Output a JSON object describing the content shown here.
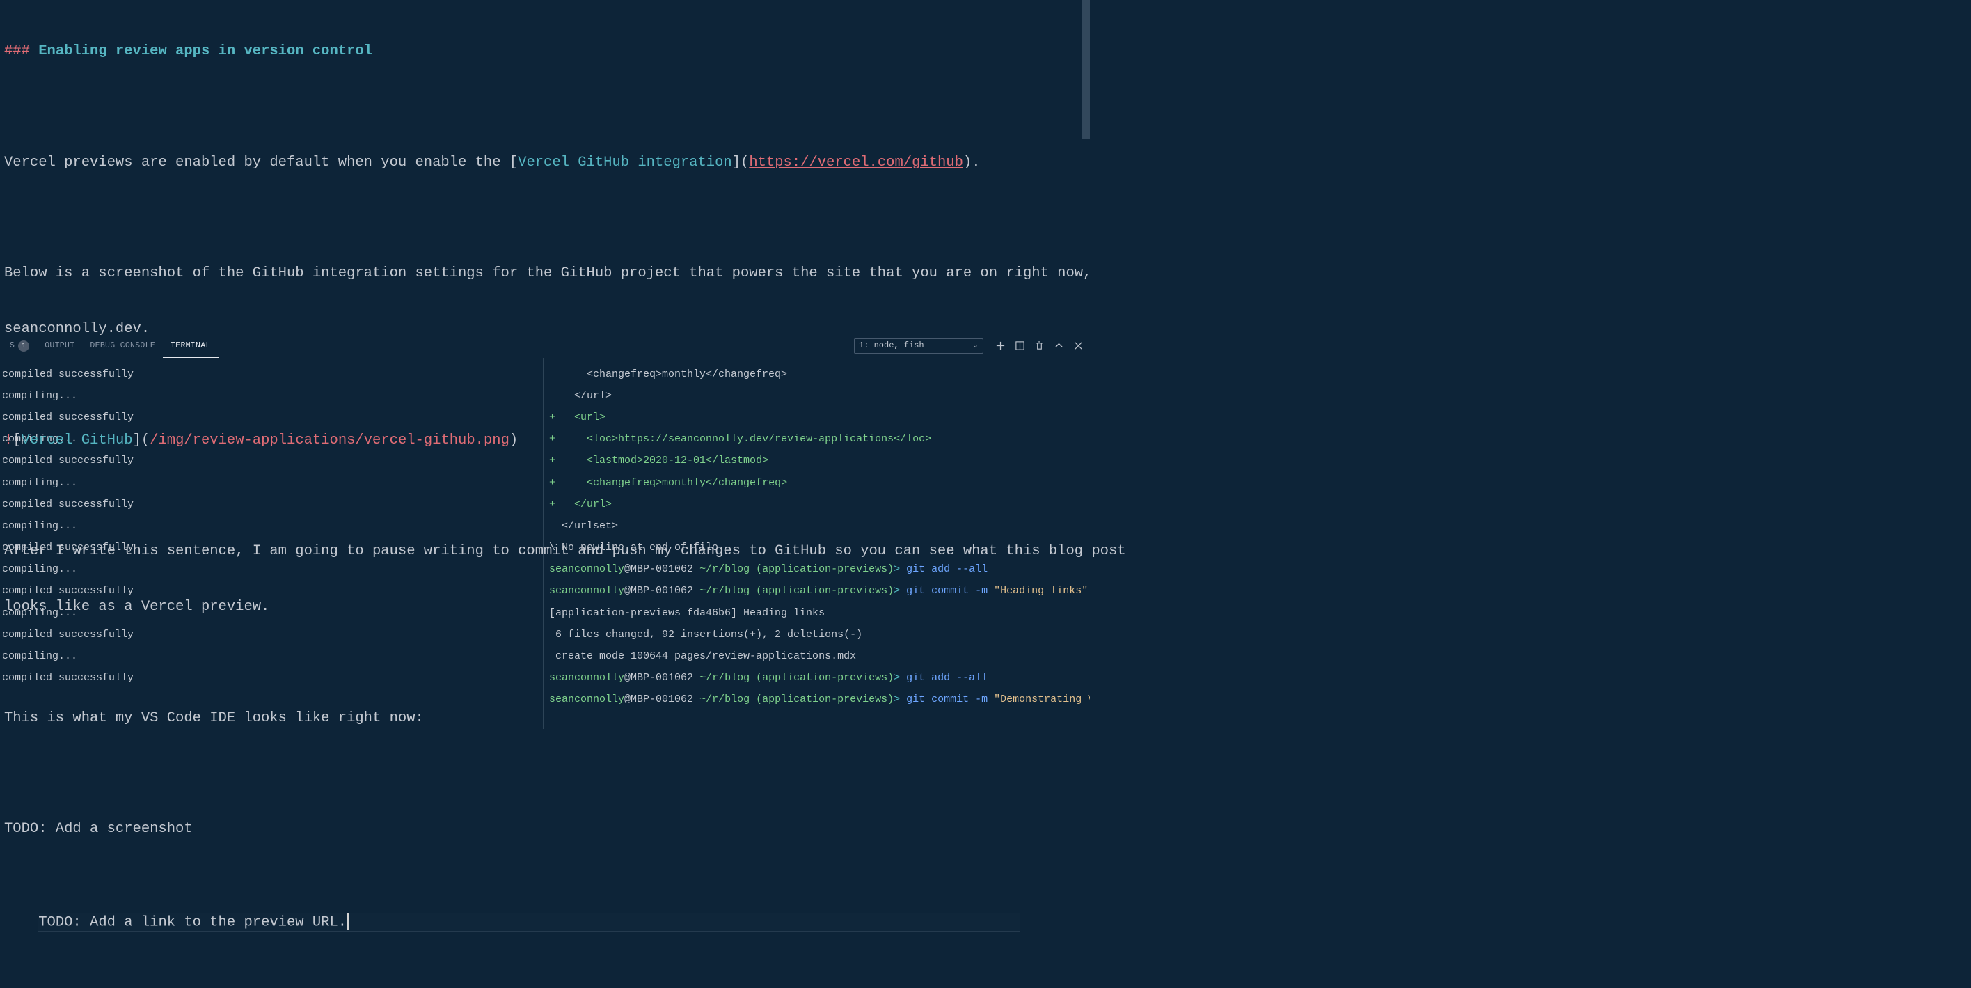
{
  "editor": {
    "heading_hash": "### ",
    "heading_text": "Enabling review apps in version control",
    "p1_pre": "Vercel previews are enabled by default when you enable the ",
    "p1_lb": "[",
    "p1_link_label": "Vercel GitHub integration",
    "p1_rb": "]",
    "p1_lp": "(",
    "p1_url": "https://vercel.com/github",
    "p1_rp": ")",
    "p1_tail": ".",
    "p2_a": "Below is a screenshot of the GitHub integration settings for the GitHub project that powers the site that you are on right now, ",
    "p2_b": "seanconnolly.dev.",
    "img_bang": "!",
    "img_lb": "[",
    "img_alt": "Vercel GitHub",
    "img_rb": "]",
    "img_lp": "(",
    "img_path": "/img/review-applications/vercel-github.png",
    "img_rp": ")",
    "p3_a": "After I write this sentence, I am going to pause writing to commit and push my changes to GitHub so you can see what this blog post ",
    "p3_b": "looks like as a Vercel preview.",
    "p4": "This is what my VS Code IDE looks like right now:",
    "todo1": "TODO: Add a screenshot",
    "todo2": "TODO: Add a link to the preview URL."
  },
  "panel": {
    "tab_problems_short": "S",
    "tab_problems_badge": "1",
    "tab_output": "OUTPUT",
    "tab_debug": "DEBUG CONSOLE",
    "tab_terminal": "TERMINAL",
    "term_select": "1: node, fish"
  },
  "term_left": {
    "l0": "compiled successfully",
    "l1": "compiling...",
    "l2": "compiled successfully",
    "l3": "compiling...",
    "l4": "compiled successfully",
    "l5": "compiling...",
    "l6": "compiled successfully",
    "l7": "compiling...",
    "l8": "compiled successfully",
    "l9": "compiling...",
    "l10": "compiled successfully",
    "l11": "compiling...",
    "l12": "compiled successfully",
    "l13": "compiling...",
    "l14": "compiled successfully"
  },
  "term_right": {
    "r0": "      <changefreq>monthly</changefreq>",
    "r1": "    </url>",
    "r2p": "+",
    "r2": "   <url>",
    "r3p": "+",
    "r3": "     <loc>https://seanconnolly.dev/review-applications</loc>",
    "r4p": "+",
    "r4": "     <lastmod>2020-12-01</lastmod>",
    "r5p": "+",
    "r5": "     <changefreq>monthly</changefreq>",
    "r6p": "+",
    "r6": "   </url>",
    "r7": "  </urlset>",
    "r8": "\\ No newline at end of file",
    "prompt_user": "seanconnolly",
    "prompt_host": "@MBP-001062 ",
    "prompt_path": "~/r/blog ",
    "prompt_branch": "(application-previews)",
    "prompt_arrow": "> ",
    "cmd_add": "git add --all",
    "cmd_commit1_a": "git commit -m ",
    "cmd_commit1_b": "\"Heading links\"",
    "commit_out1": "[application-previews fda46b6] Heading links",
    "commit_out2": " 6 files changed, 92 insertions(+), 2 deletions(-)",
    "commit_out3": " create mode 100644 pages/review-applications.mdx",
    "cmd_commit2_a": "git commit -m ",
    "cmd_commit2_b": "\"Demonstrating Vercel preview\""
  }
}
